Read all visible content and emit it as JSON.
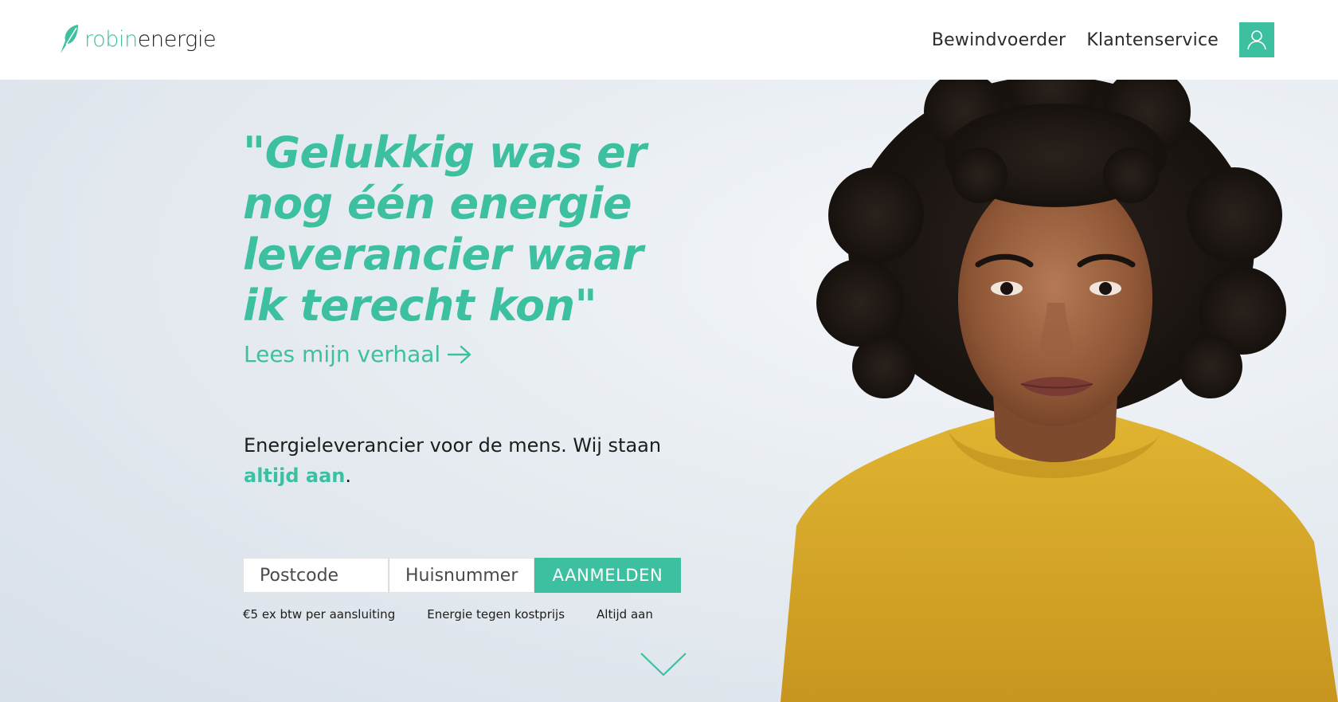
{
  "header": {
    "logo": {
      "part1": "robin",
      "part2": "energie",
      "icon": "feather-bolt-icon"
    },
    "nav": [
      {
        "label": "Bewindvoerder"
      },
      {
        "label": "Klantenservice"
      }
    ],
    "account_icon": "user-icon"
  },
  "hero": {
    "quote": "\"Gelukkig was er nog één energie leverancier waar ik terecht kon\"",
    "story_link": "Lees mijn verhaal",
    "story_link_icon": "arrow-right-icon",
    "tagline_main": "Energieleverancier voor de mens. Wij staan",
    "tagline_accent": "altijd aan",
    "tagline_end": ".",
    "form": {
      "postcode_placeholder": "Postcode",
      "housenumber_placeholder": "Huisnummer",
      "submit_label": "AANMELDEN"
    },
    "usps": [
      "€5 ex btw per aansluiting",
      "Energie tegen kostprijs",
      "Altijd aan"
    ],
    "scroll_icon": "chevron-down-icon"
  },
  "colors": {
    "accent": "#3cc0a0",
    "text": "#1d1d1b",
    "sweater": "#d9a92a",
    "background": "#e8edf2"
  }
}
